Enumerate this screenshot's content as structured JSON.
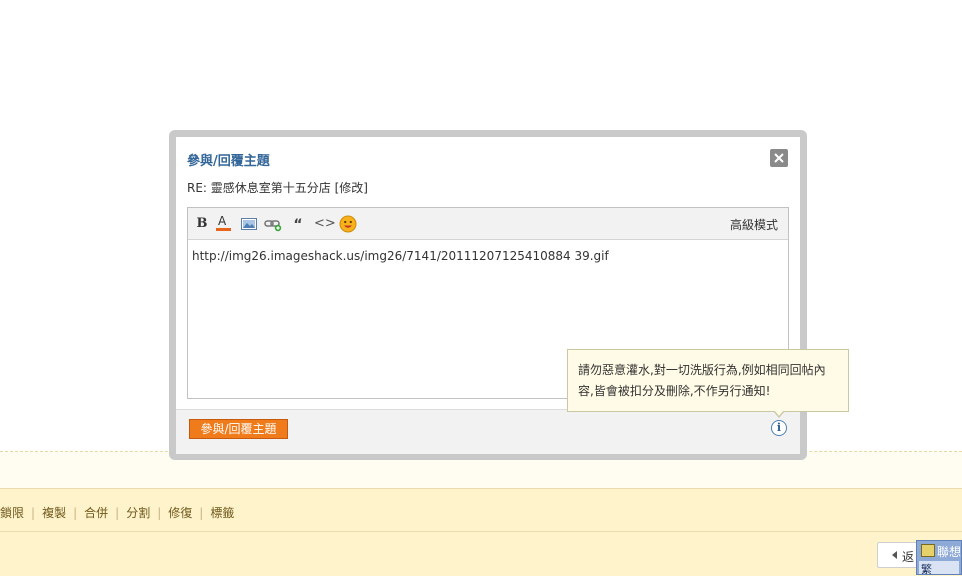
{
  "dialog": {
    "title": "參與/回覆主題",
    "subject": "RE: 靈感休息室第十五分店 [修改]",
    "advanced_mode_label": "高級模式",
    "toolbar": {
      "bold_label": "B",
      "color_label": "A",
      "quote_label": "“",
      "code_label": "<>"
    },
    "editor_content": "http://img26.imageshack.us/img26/7141/20111207125410884 39.gif",
    "submit_label": "參與/回覆主題",
    "info_label": "i"
  },
  "tooltip": {
    "text": "請勿惡意灌水,對一切洗版行為,例如相同回帖內容,皆會被扣分及刪除,不作另行通知!"
  },
  "admin_bar": {
    "links": [
      "鎖限",
      "複製",
      "合併",
      "分割",
      "修復",
      "標籤"
    ]
  },
  "back_button": {
    "label": "返"
  },
  "ime": {
    "label": "聯想",
    "sub_label": "繁"
  },
  "colors": {
    "title_blue": "#336699",
    "submit_orange": "#f07b1a",
    "admin_bar_bg": "#fff3cc",
    "tooltip_bg": "#fffbe6"
  }
}
